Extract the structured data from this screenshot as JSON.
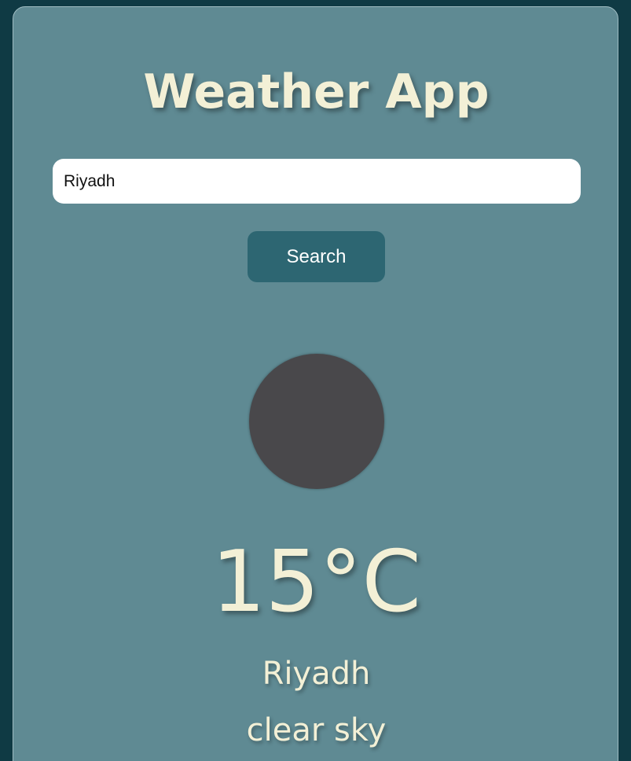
{
  "app": {
    "title": "Weather App"
  },
  "search": {
    "value": "Riyadh",
    "button_label": "Search"
  },
  "weather": {
    "icon": "weather-icon-placeholder",
    "temperature": "15°C",
    "city": "Riyadh",
    "description": "clear sky"
  },
  "colors": {
    "page_background": "#0f3a44",
    "card_background": "#5f8a93",
    "text_accent": "#f3f0d6",
    "button_background": "#2d6672",
    "icon_placeholder": "#49484b"
  }
}
